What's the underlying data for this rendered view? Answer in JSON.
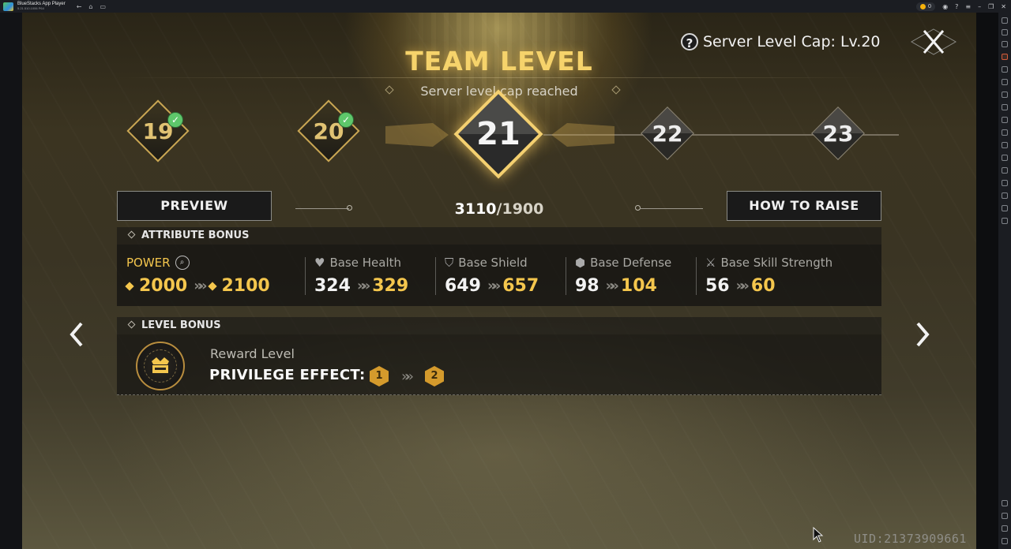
{
  "window": {
    "app_title": "BlueStacks App Player",
    "app_subtitle": "5.21.510.1006 P64",
    "coins": "0"
  },
  "header": {
    "title": "TEAM LEVEL",
    "subtitle": "Server level cap reached",
    "help_icon": "question-icon",
    "server_cap": "Server Level Cap: Lv.20",
    "close_icon": "close-icon"
  },
  "levels": [
    {
      "label": "19",
      "completed": true
    },
    {
      "label": "20",
      "completed": true
    },
    {
      "label": "21",
      "current": true
    },
    {
      "label": "22"
    },
    {
      "label": "23"
    }
  ],
  "actions": {
    "preview_label": "PREVIEW",
    "how_to_raise_label": "HOW TO RAISE"
  },
  "progress": {
    "current": "3110",
    "max": "/1900"
  },
  "attribute_bonus": {
    "heading": "ATTRIBUTE BONUS",
    "items": [
      {
        "label": "POWER",
        "from": "2000",
        "to": "2100",
        "icon": "magnifier-icon"
      },
      {
        "label": "Base Health",
        "from": "324",
        "to": "329",
        "icon": "heart-icon"
      },
      {
        "label": "Base Shield",
        "from": "649",
        "to": "657",
        "icon": "shield-icon"
      },
      {
        "label": "Base Defense",
        "from": "98",
        "to": "104",
        "icon": "defense-icon"
      },
      {
        "label": "Base Skill Strength",
        "from": "56",
        "to": "60",
        "icon": "crossed-swords-icon"
      }
    ]
  },
  "level_bonus": {
    "heading": "LEVEL BONUS",
    "reward_label": "Reward Level",
    "privilege_label": "PRIVILEGE EFFECT:",
    "from": "1",
    "to": "2"
  },
  "footer": {
    "uid": "UID:2137390966​1"
  },
  "colors": {
    "gold": "#f4c64d",
    "title_gold": "#f6d36b",
    "check_green": "#5ec76b"
  }
}
